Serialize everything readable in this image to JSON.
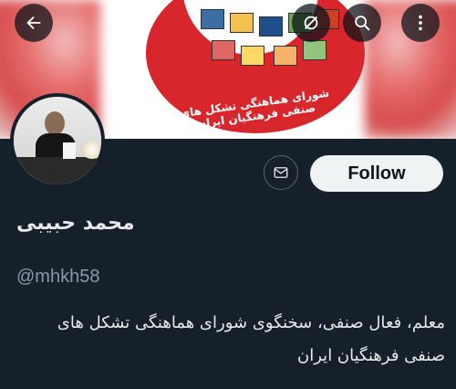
{
  "header": {
    "back_icon": "arrow-left-icon",
    "circle_slash_icon": "circle-slash-icon",
    "search_icon": "search-icon",
    "more_icon": "more-vertical-icon"
  },
  "banner": {
    "emblem_text": "شورای هماهنگی تشکل های صنفی فرهنگیان ایران",
    "colors": {
      "emblem_red": "#d8262d"
    }
  },
  "profile": {
    "display_name": "محمد حبیبی",
    "handle": "@mhkh58",
    "bio": "معلم، فعال صنفی، سخنگوی شورای هماهنگی تشکل های صنفی فرهنگیان ایران"
  },
  "actions": {
    "message_icon": "mail-icon",
    "follow_label": "Follow"
  },
  "theme": {
    "background": "#15202b",
    "text": "#e7e9ea",
    "muted": "#8b98a5",
    "follow_bg": "#eff3f4"
  }
}
